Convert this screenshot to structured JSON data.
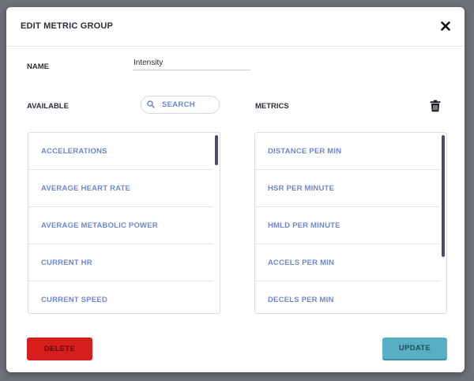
{
  "dialog": {
    "title": "EDIT METRIC GROUP",
    "close_icon": "close-icon"
  },
  "name_field": {
    "label": "NAME",
    "value": "Intensity"
  },
  "available": {
    "label": "AVAILABLE",
    "search_placeholder": "SEARCH",
    "items": [
      "ACCELERATIONS",
      "AVERAGE HEART RATE",
      "AVERAGE METABOLIC POWER",
      "CURRENT HR",
      "CURRENT SPEED"
    ]
  },
  "metrics": {
    "label": "METRICS",
    "delete_icon": "trash-icon",
    "items": [
      "DISTANCE PER MIN",
      "HSR PER MINUTE",
      "HMLD PER MINUTE",
      "ACCELS PER MIN",
      "DECELS PER MIN"
    ]
  },
  "buttons": {
    "delete": "DELETE",
    "update": "UPDATE"
  },
  "colors": {
    "accent_text": "#6e86cf",
    "delete_bg": "#d81d1d",
    "update_bg": "#58aec4",
    "backdrop": "#6e7079"
  }
}
